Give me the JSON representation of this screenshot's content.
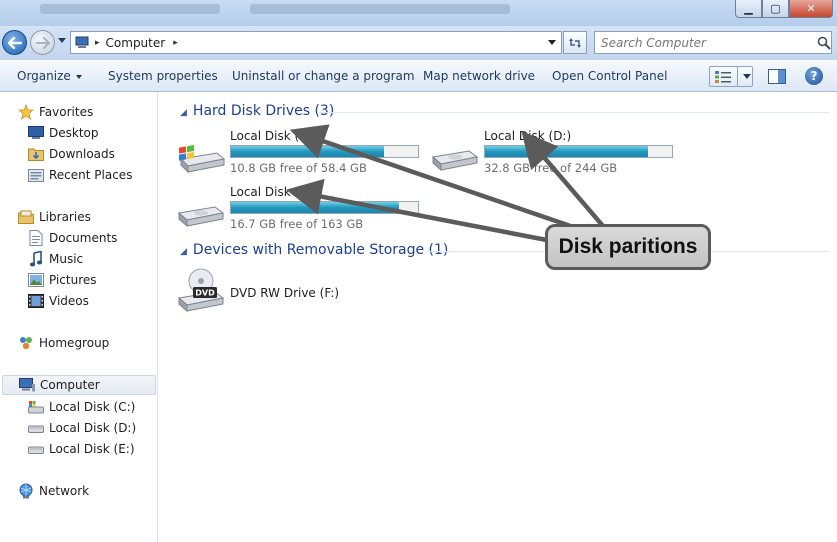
{
  "window": {
    "minimize_glyph": "▁",
    "maximize_glyph": "▢",
    "close_glyph": "✕"
  },
  "address": {
    "crumb": "Computer",
    "sep": "▸",
    "after_sep": "▸"
  },
  "search": {
    "placeholder": "Search Computer"
  },
  "commands": {
    "organize": "Organize",
    "system_properties": "System properties",
    "uninstall": "Uninstall or change a program",
    "map_network": "Map network drive",
    "control_panel": "Open Control Panel",
    "help_glyph": "?"
  },
  "nav": {
    "favorites": "Favorites",
    "desktop": "Desktop",
    "downloads": "Downloads",
    "recent": "Recent Places",
    "libraries": "Libraries",
    "documents": "Documents",
    "music": "Music",
    "pictures": "Pictures",
    "videos": "Videos",
    "homegroup": "Homegroup",
    "computer": "Computer",
    "disk_c": "Local Disk (C:)",
    "disk_d": "Local Disk (D:)",
    "disk_e": "Local Disk (E:)",
    "network": "Network"
  },
  "groups": {
    "hard_disks": "Hard Disk Drives (3)",
    "removable": "Devices with Removable Storage (1)"
  },
  "drives": [
    {
      "name": "Local Disk (C:)",
      "free": "10.8 GB free of 58.4 GB",
      "used_fraction": 0.82
    },
    {
      "name": "Local Disk (D:)",
      "free": "32.8 GB free of 244 GB",
      "used_fraction": 0.87
    },
    {
      "name": "Local Disk (E:)",
      "free": "16.7 GB free of 163 GB",
      "used_fraction": 0.9
    }
  ],
  "removable": {
    "name": "DVD RW Drive (F:)",
    "badge": "DVD"
  },
  "annotation": {
    "label": "Disk paritions"
  },
  "colors": {
    "accent": "#1e3f8e",
    "bar_fill": "#2597bd",
    "callout_border": "#5b5b5b"
  }
}
